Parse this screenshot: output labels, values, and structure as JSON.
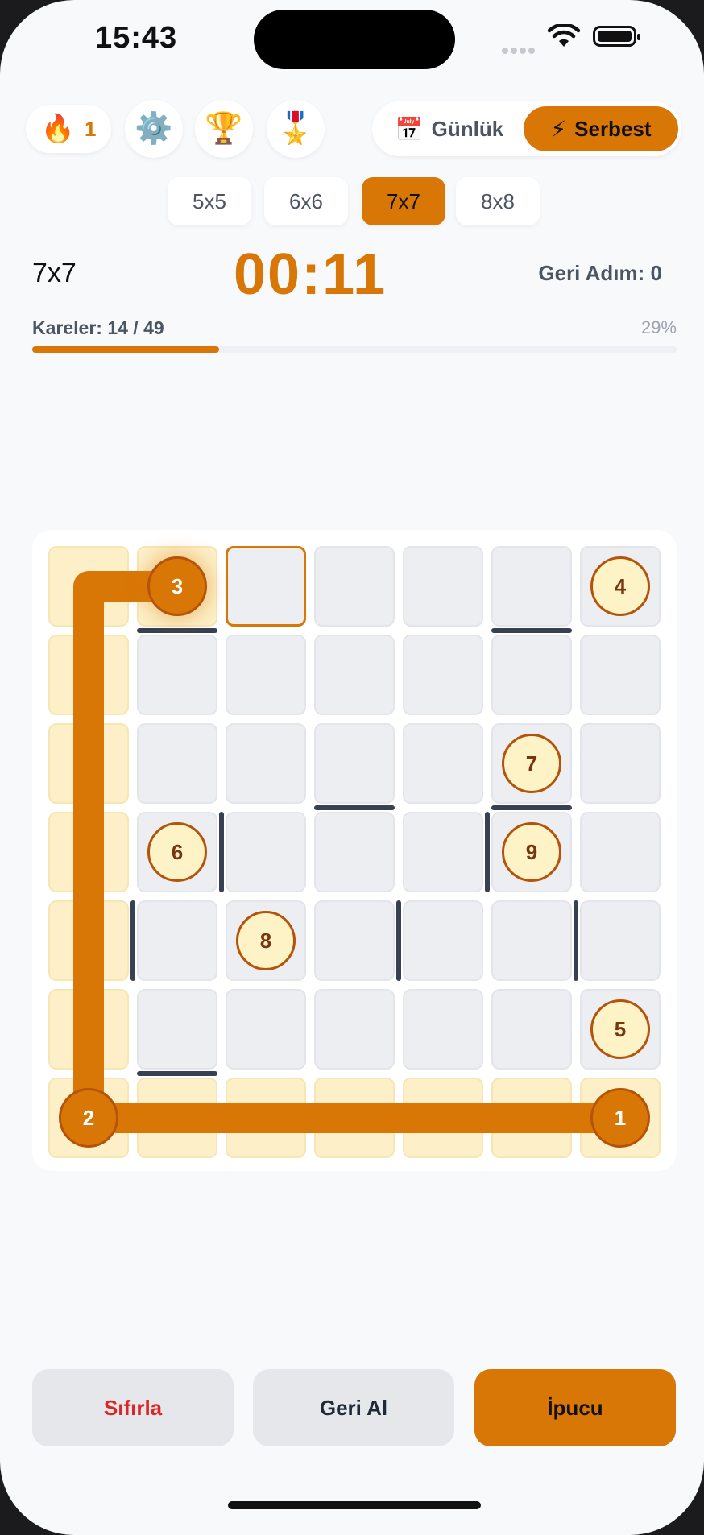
{
  "status_bar": {
    "time": "15:43"
  },
  "top_bar": {
    "streak": {
      "icon": "fire-icon",
      "glyph": "🔥",
      "count": "1"
    },
    "settings": {
      "icon": "gear-icon",
      "glyph": "⚙️"
    },
    "leaderboard": {
      "icon": "trophy-icon",
      "glyph": "🏆"
    },
    "achievements": {
      "icon": "medal-icon",
      "glyph": "🎖️"
    },
    "modes": {
      "daily": {
        "icon": "calendar-icon",
        "glyph": "📅",
        "label": "Günlük"
      },
      "free": {
        "icon": "lightning-icon",
        "glyph": "⚡",
        "label": "Serbest",
        "selected": true
      }
    }
  },
  "size_tabs": [
    {
      "label": "5x5",
      "active": false
    },
    {
      "label": "6x6",
      "active": false
    },
    {
      "label": "7x7",
      "active": true
    },
    {
      "label": "8x8",
      "active": false
    }
  ],
  "info": {
    "grid_size": "7x7",
    "timer": "00:11",
    "undo_count": "Geri Adım: 0",
    "cells_label": "Kareler: 14 / 49",
    "percent_label": "29%",
    "progress_fraction": 0.29
  },
  "board": {
    "rows": 7,
    "cols": 7,
    "visited": [
      [
        0,
        0
      ],
      [
        0,
        1
      ],
      [
        1,
        0
      ],
      [
        2,
        0
      ],
      [
        3,
        0
      ],
      [
        4,
        0
      ],
      [
        5,
        0
      ],
      [
        6,
        0
      ],
      [
        6,
        1
      ],
      [
        6,
        2
      ],
      [
        6,
        3
      ],
      [
        6,
        4
      ],
      [
        6,
        5
      ],
      [
        6,
        6
      ]
    ],
    "current": [
      0,
      2
    ],
    "numbers": [
      {
        "label": "1",
        "row": 6,
        "col": 6,
        "done": true
      },
      {
        "label": "2",
        "row": 6,
        "col": 0,
        "done": true
      },
      {
        "label": "3",
        "row": 0,
        "col": 1,
        "done": true,
        "last": true
      },
      {
        "label": "4",
        "row": 0,
        "col": 6,
        "done": false
      },
      {
        "label": "5",
        "row": 5,
        "col": 6,
        "done": false
      },
      {
        "label": "6",
        "row": 3,
        "col": 1,
        "done": false
      },
      {
        "label": "7",
        "row": 2,
        "col": 5,
        "done": false
      },
      {
        "label": "8",
        "row": 4,
        "col": 2,
        "done": false
      },
      {
        "label": "9",
        "row": 3,
        "col": 5,
        "done": false
      }
    ],
    "path": [
      [
        6,
        6
      ],
      [
        6,
        0
      ],
      [
        0,
        0
      ],
      [
        0,
        1
      ]
    ],
    "walls_horizontal_below": [
      [
        0,
        1
      ],
      [
        0,
        5
      ],
      [
        2,
        3
      ],
      [
        2,
        5
      ],
      [
        5,
        1
      ]
    ],
    "walls_vertical_left_of": [
      [
        3,
        2
      ],
      [
        3,
        5
      ],
      [
        4,
        1
      ],
      [
        4,
        4
      ],
      [
        4,
        6
      ]
    ],
    "path_color": "#d97706",
    "visited_color": "#fdf0c8"
  },
  "actions": {
    "reset": "Sıfırla",
    "undo": "Geri Al",
    "hint": "İpucu"
  },
  "colors": {
    "accent": "#d97706",
    "danger": "#dc2626",
    "background": "#f8f9fb"
  }
}
